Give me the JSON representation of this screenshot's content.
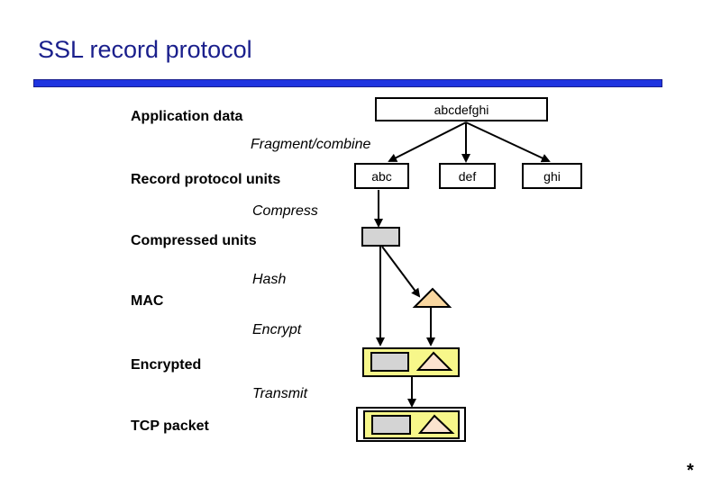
{
  "title": "SSL record protocol",
  "stages": {
    "application_data": "Application data",
    "record_protocol_units": "Record protocol units",
    "compressed_units": "Compressed units",
    "mac": "MAC",
    "encrypted": "Encrypted",
    "tcp_packet": "TCP packet"
  },
  "operations": {
    "fragment": "Fragment/combine",
    "compress": "Compress",
    "hash": "Hash",
    "encrypt": "Encrypt",
    "transmit": "Transmit"
  },
  "boxes": {
    "app_data": "abcdefghi",
    "fragments": [
      "abc",
      "def",
      "ghi"
    ]
  },
  "colors": {
    "title": "#1a1f8c",
    "rule": "#1f35e0",
    "compressed_fill": "#d4d4d4",
    "mac_fill": "#f9d7a0",
    "mac_fill_light": "#fbe3cf",
    "encrypted_fill": "#f7f78a"
  },
  "footer_mark": "*"
}
